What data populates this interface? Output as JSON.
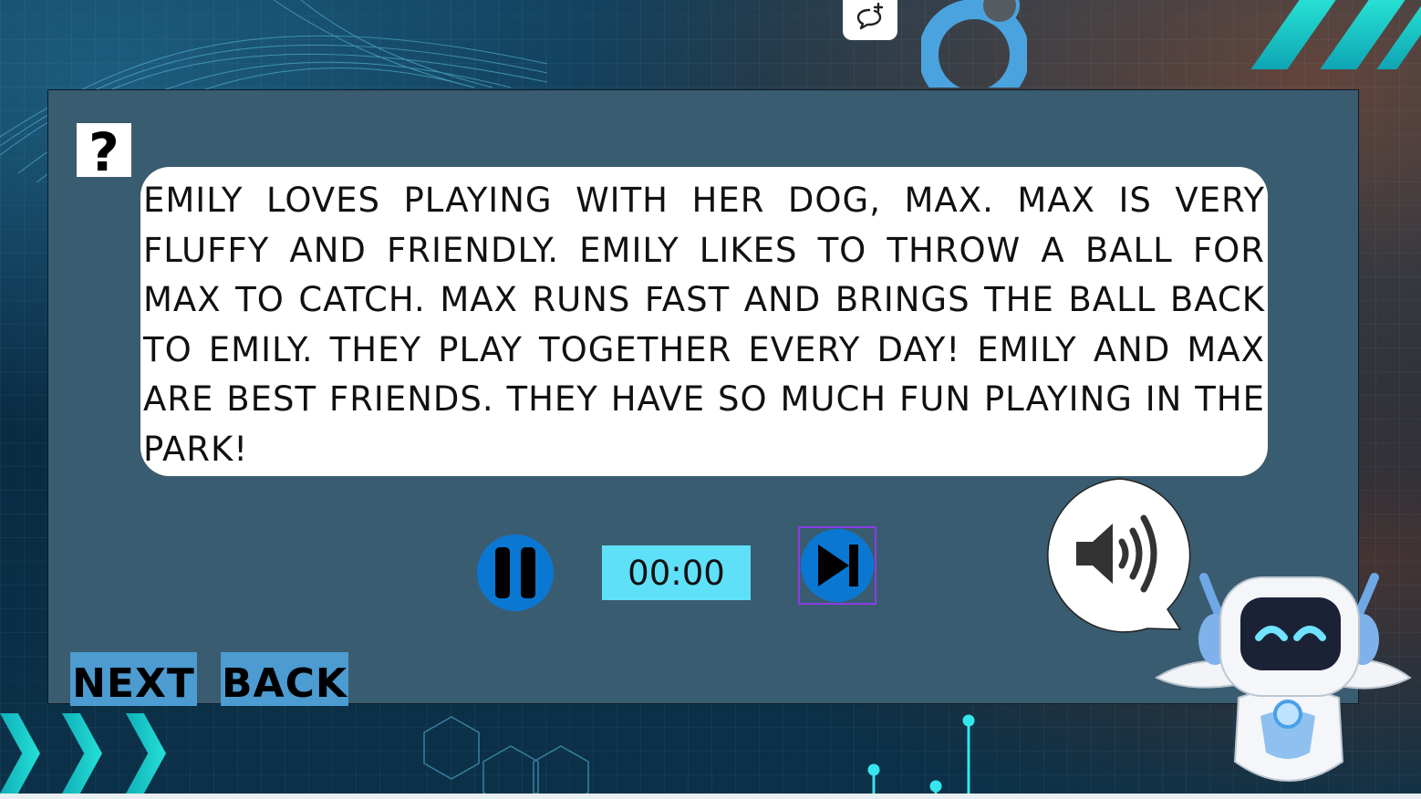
{
  "story": {
    "text": "EMILY LOVES PLAYING WITH HER DOG, MAX. MAX IS VERY FLUFFY AND FRIENDLY. EMILY LIKES TO THROW A BALL FOR MAX TO CATCH. MAX RUNS FAST AND BRINGS THE BALL BACK TO EMILY. THEY PLAY TOGETHER EVERY DAY! EMILY AND MAX ARE BEST FRIENDS. THEY HAVE SO MUCH FUN PLAYING IN THE PARK!"
  },
  "help": {
    "label": "?"
  },
  "player": {
    "time": "00:00",
    "pause_icon": "pause-icon",
    "next_icon": "skip-next-icon",
    "speaker_icon": "speaker-volume-icon"
  },
  "nav": {
    "next_label": "NEXT",
    "back_label": "BACK"
  },
  "toolbar": {
    "comment_icon": "comment-add-icon"
  },
  "colors": {
    "panel": "#3a5c70",
    "control_blue": "#0a78d2",
    "timer_bg": "#5ee0f8",
    "nav_bg": "#4c9bd1",
    "focus_outline": "#8a3de6"
  }
}
